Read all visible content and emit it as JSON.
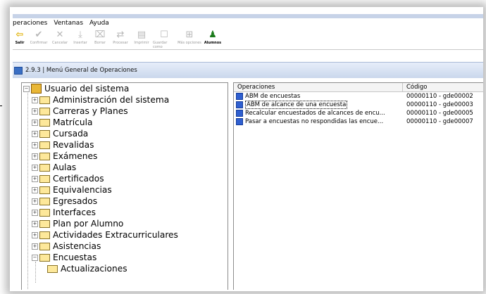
{
  "menu": {
    "items": [
      "peraciones",
      "Ventanas",
      "Ayuda"
    ]
  },
  "toolbar": {
    "buttons": [
      {
        "label": "Salir",
        "icon": "arrow-left-icon",
        "active": true
      },
      {
        "label": "Confirmar",
        "icon": "check-icon",
        "active": false
      },
      {
        "label": "Cancelar",
        "icon": "x-icon",
        "active": false
      },
      {
        "label": "Insertar",
        "icon": "insert-icon",
        "active": false
      },
      {
        "label": "Borrar",
        "icon": "delete-icon",
        "active": false
      },
      {
        "label": "Procesar",
        "icon": "process-icon",
        "active": false
      },
      {
        "label": "Imprimir",
        "icon": "print-icon",
        "active": false
      },
      {
        "label": "Guardar como",
        "icon": "save-as-icon",
        "active": false
      },
      {
        "label": "Más opciones",
        "icon": "more-options-icon",
        "active": false
      },
      {
        "label": "Alumnos",
        "icon": "student-icon",
        "active": true
      }
    ]
  },
  "window": {
    "title": "2.9.3 | Menú General de Operaciones"
  },
  "tree": {
    "root": "Usuario del sistema",
    "items": [
      "Administración del sistema",
      "Carreras y Planes",
      "Matrícula",
      "Cursada",
      "Revalidas",
      "Exámenes",
      "Aulas",
      "Certificados",
      "Equivalencias",
      "Egresados",
      "Interfaces",
      "Plan por Alumno",
      "Actividades Extracurriculares",
      "Asistencias",
      "Encuestas"
    ],
    "child_partial": "Actualizaciones"
  },
  "list": {
    "headers": [
      "Operaciones",
      "Código"
    ],
    "rows": [
      {
        "op": "ABM de encuestas",
        "code": "00000110 - gde00002"
      },
      {
        "op": "ABM de alcance de una encuesta",
        "code": "00000110 - gde00003"
      },
      {
        "op": "Recalcular encuestados de alcances de encu...",
        "code": "00000110 - gde00005"
      },
      {
        "op": "Pasar a encuestas no respondidas las encue...",
        "code": "00000110 - gde00007"
      }
    ],
    "selected_index": 1
  }
}
